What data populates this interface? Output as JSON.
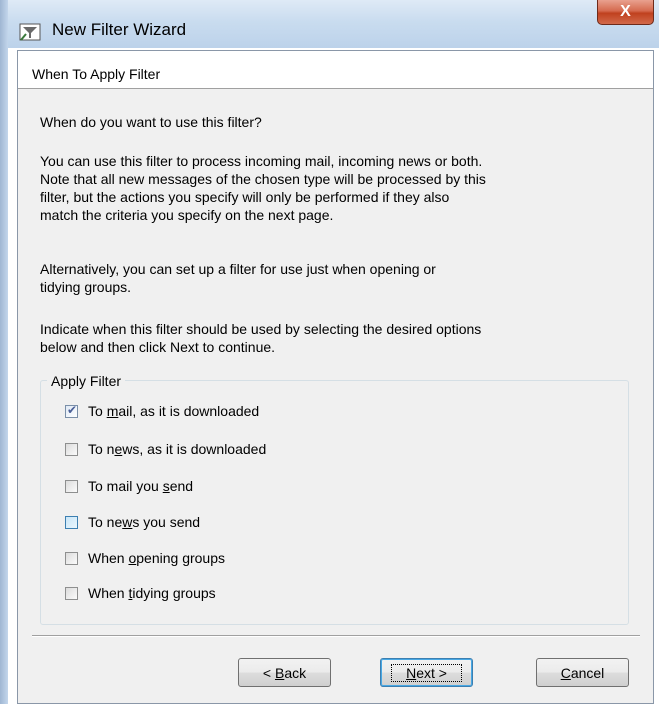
{
  "window": {
    "title": "New Filter Wizard",
    "close_glyph": "X"
  },
  "page": {
    "header": "When To Apply Filter",
    "question": "When do you want to use this filter?",
    "para1_lines": [
      "You can use this filter to process incoming mail, incoming news or both.",
      "Note that all new messages of the chosen type will be processed by this",
      "filter, but the actions you specify will only be performed if they also",
      "match the criteria you specify on the next page."
    ],
    "para2_lines": [
      "Alternatively, you can set up a filter for use just when opening or",
      "tidying groups."
    ],
    "para3_lines": [
      "Indicate when this filter should be used by selecting the desired options",
      "below and then click Next to continue."
    ]
  },
  "apply_filter": {
    "label": "Apply Filter",
    "options": [
      {
        "pre": "To ",
        "u": "m",
        "post": "ail, as it is downloaded",
        "checked": true
      },
      {
        "pre": "To n",
        "u": "e",
        "post": "ws, as it is downloaded",
        "checked": false
      },
      {
        "pre": "To mail you ",
        "u": "s",
        "post": "end",
        "checked": false
      },
      {
        "pre": "To ne",
        "u": "w",
        "post": "s you send",
        "checked": false
      },
      {
        "pre": "When ",
        "u": "o",
        "post": "pening groups",
        "checked": false
      },
      {
        "pre": "When ",
        "u": "t",
        "post": "idying groups",
        "checked": false
      }
    ]
  },
  "buttons": {
    "back_pre": "< ",
    "back_u": "B",
    "back_post": "ack",
    "next_u": "N",
    "next_post": "ext >",
    "cancel_u": "C",
    "cancel_post": "ancel"
  },
  "colors": {
    "close_button": "#c9452a",
    "client_bg": "#f0f0f0",
    "title_bar": "#c9dcef"
  }
}
